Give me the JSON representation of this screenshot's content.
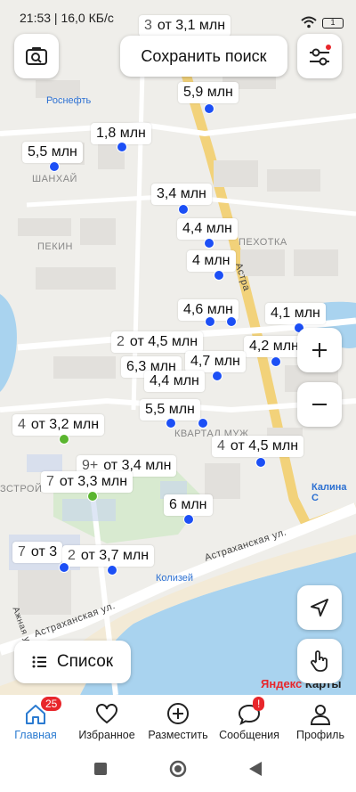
{
  "status": {
    "time": "21:53",
    "speed": "16,0 КБ/с",
    "battery": "1"
  },
  "toolbar": {
    "save_search": "Сохранить поиск"
  },
  "map": {
    "places": {
      "rosneft": "Роснефть",
      "shanhai": "ШАНХАЙ",
      "pekin": "ПЕКИН",
      "pekhotka": "ПЕХОТКА",
      "kvartal": "КВАРТАЛ МУЖ",
      "kalina": "Калина С",
      "koliseum": "Колизей",
      "ostroy": "ЗСТРОЙ",
      "street_astr1": "Астраханская ул.",
      "street_astr2": "Астраханская ул.",
      "street_astr3": "Астра",
      "street_left": "Ажная ул."
    },
    "labels": [
      {
        "count": "3",
        "price": "от 3,1 млн"
      },
      {
        "count": "",
        "price": "5,9 млн"
      },
      {
        "count": "",
        "price": "1,8 млн"
      },
      {
        "count": "",
        "price": "5,5 млн"
      },
      {
        "count": "",
        "price": "3,4 млн"
      },
      {
        "count": "",
        "price": "4,4 млн"
      },
      {
        "count": "",
        "price": "4 млн"
      },
      {
        "count": "",
        "price": "4,6 млн"
      },
      {
        "count": "",
        "price": "4,1 млн"
      },
      {
        "count": "2",
        "price": "от 4,5 млн"
      },
      {
        "count": "",
        "price": "4,2 млн"
      },
      {
        "count": "",
        "price": "6,3 млн"
      },
      {
        "count": "",
        "price": "4,7 млн"
      },
      {
        "count": "",
        "price": "4,4 млн"
      },
      {
        "count": "",
        "price": "5,5 млн"
      },
      {
        "count": "4",
        "price": "от 3,2 млн"
      },
      {
        "count": "4",
        "price": "от 4,5 млн"
      },
      {
        "count": "9+",
        "price": "от 3,4 млн"
      },
      {
        "count": "7",
        "price": "от 3,3 млн"
      },
      {
        "count": "",
        "price": "6 млн"
      },
      {
        "count": "7",
        "price": "от 3"
      },
      {
        "count": "2",
        "price": "от 3,7 млн"
      }
    ],
    "yandex": {
      "brand": "Яндекс",
      "suffix": "Карты"
    }
  },
  "list_button": "Список",
  "tabs": [
    {
      "label": "Главная",
      "badge": "25",
      "icon": "home-icon"
    },
    {
      "label": "Избранное",
      "icon": "heart-icon"
    },
    {
      "label": "Разместить",
      "icon": "plus-circle-icon"
    },
    {
      "label": "Сообщения",
      "badge": "!",
      "icon": "chat-icon"
    },
    {
      "label": "Профиль",
      "icon": "profile-icon"
    }
  ],
  "colors": {
    "accent": "#2b7bd1",
    "marker": "#1c4ff5",
    "marker_green": "#5ab52f",
    "badge": "#e8262b"
  }
}
